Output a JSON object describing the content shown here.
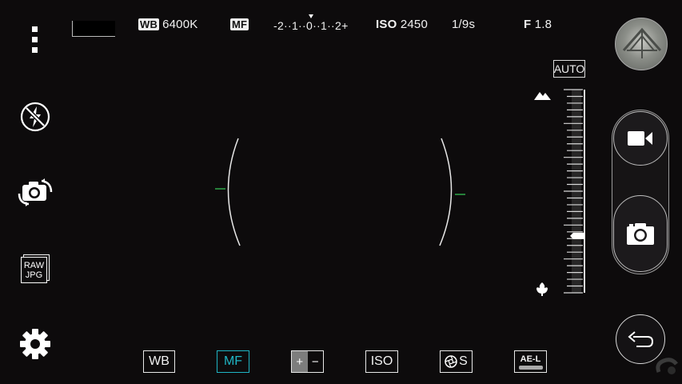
{
  "top": {
    "wb_tag": "WB",
    "wb_value": "6400K",
    "focus_tag": "MF",
    "ev_scale": "-2··1··0··1··2+",
    "iso_tag": "ISO",
    "iso_value": "2450",
    "shutter": "1/9s",
    "aperture_tag": "F",
    "aperture_value": "1.8"
  },
  "left_sidebar": {
    "items": [
      {
        "name": "menu",
        "icon": "more-vert-icon"
      },
      {
        "name": "flash",
        "icon": "flash-off-icon"
      },
      {
        "name": "switch-camera",
        "icon": "camera-switch-icon"
      },
      {
        "name": "raw-jpg",
        "icon": "raw-jpg-icon",
        "line1": "RAW",
        "line2": "JPG"
      },
      {
        "name": "settings",
        "icon": "gear-icon"
      }
    ]
  },
  "bottom_bar": {
    "wb": "WB",
    "mf": "MF",
    "ev": "+/−",
    "ev_plus": "+",
    "ev_minus": "−",
    "iso": "ISO",
    "shutter": "S",
    "ael": "AE-L"
  },
  "focus_slider": {
    "mode": "AUTO",
    "top_icon": "mountain-icon",
    "bottom_icon": "flower-macro-icon",
    "position": 0.72
  },
  "right_panel": {
    "video_icon": "video-camera-icon",
    "shutter_icon": "camera-icon",
    "back_icon": "back-arrow-icon"
  },
  "colors": {
    "accent": "#1fb5c4",
    "focus_marker": "#2fa84a",
    "background": "#0d0b0c"
  }
}
